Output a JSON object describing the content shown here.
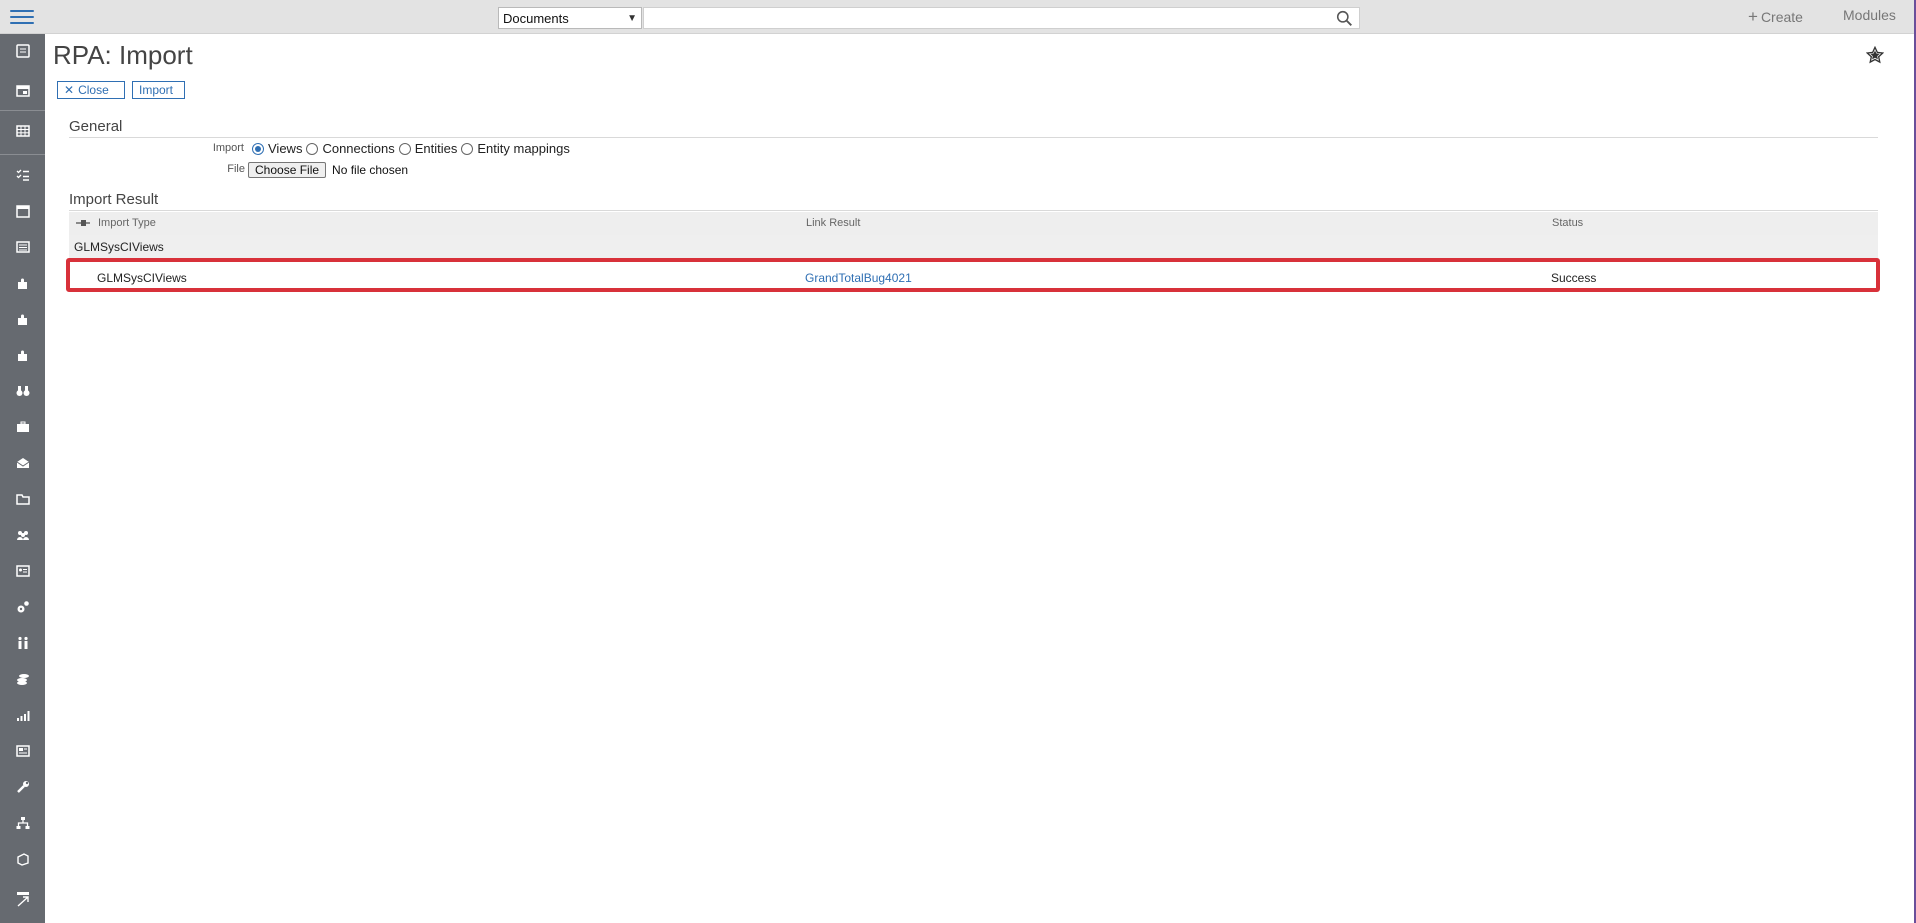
{
  "topbar": {
    "search_scope": "Documents",
    "search_placeholder": "",
    "create_label": "Create",
    "modules_label": "Modules"
  },
  "sidebar": {
    "icons": [
      "address-book-icon",
      "window-icon",
      "grid-icon",
      "checklist-icon",
      "calendar-icon",
      "list-icon",
      "puzzle-icon",
      "puzzle-icon",
      "puzzle-icon",
      "binoculars-icon",
      "briefcase-icon",
      "mail-icon",
      "folder-icon",
      "users-icon",
      "id-card-icon",
      "gears-icon",
      "people-icon",
      "coins-icon",
      "chart-icon",
      "newspaper-icon",
      "wrench-icon",
      "org-chart-icon",
      "box-icon",
      "window-arrow-icon"
    ]
  },
  "page": {
    "title": "RPA: Import",
    "close_label": "Close",
    "import_label": "Import"
  },
  "general": {
    "title": "General",
    "import_label": "Import",
    "options": [
      "Views",
      "Connections",
      "Entities",
      "Entity mappings"
    ],
    "selected": "Views",
    "file_label": "File",
    "choose_file_label": "Choose File",
    "file_status": "No file chosen"
  },
  "result": {
    "title": "Import Result",
    "columns": [
      "Import Type",
      "Link Result",
      "Status"
    ],
    "group": "GLMSysCIViews",
    "rows": [
      {
        "type": "GLMSysCIViews",
        "link": "GrandTotalBug4021",
        "status": "Success"
      }
    ]
  },
  "colors": {
    "accent": "#2f6fb3",
    "sidebar": "#666a70",
    "highlight": "#d8313a"
  }
}
